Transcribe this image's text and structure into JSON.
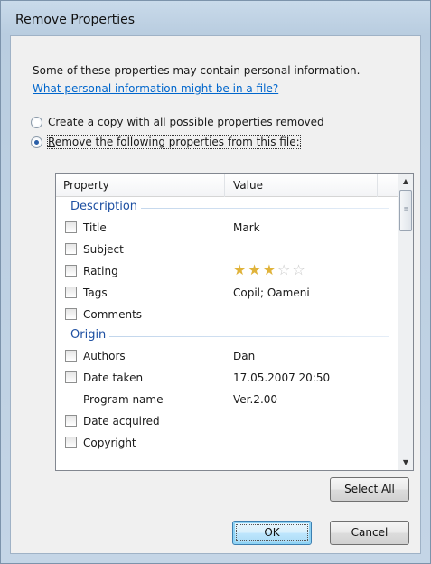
{
  "window": {
    "title": "Remove Properties"
  },
  "intro": {
    "text": "Some of these properties may contain personal information.",
    "link": "What personal information might be in a file?"
  },
  "options": {
    "copy_prefix": "C",
    "copy_rest": "reate a copy with all possible properties removed",
    "remove_prefix": "R",
    "remove_rest": "emove the following properties from this file:",
    "selected": "remove"
  },
  "list": {
    "columns": {
      "property": "Property",
      "value": "Value"
    },
    "groups": [
      {
        "name": "Description",
        "rows": [
          {
            "label": "Title",
            "value": "Mark",
            "checkbox": true
          },
          {
            "label": "Subject",
            "value": "",
            "checkbox": true
          },
          {
            "label": "Rating",
            "value": "",
            "checkbox": true,
            "rating": 3,
            "rating_max": 5
          },
          {
            "label": "Tags",
            "value": "Copil; Oameni",
            "checkbox": true
          },
          {
            "label": "Comments",
            "value": "",
            "checkbox": true
          }
        ]
      },
      {
        "name": "Origin",
        "rows": [
          {
            "label": "Authors",
            "value": "Dan",
            "checkbox": true
          },
          {
            "label": "Date taken",
            "value": "17.05.2007 20:50",
            "checkbox": true
          },
          {
            "label": "Program name",
            "value": "Ver.2.00",
            "checkbox": false
          },
          {
            "label": "Date acquired",
            "value": "",
            "checkbox": true
          },
          {
            "label": "Copyright",
            "value": "",
            "checkbox": true
          }
        ]
      }
    ]
  },
  "buttons": {
    "select_all_prefix": "Select ",
    "select_all_key": "A",
    "select_all_rest": "ll",
    "ok": "OK",
    "cancel": "Cancel"
  },
  "colors": {
    "group_heading": "#1e50a2",
    "link": "#0066cc",
    "star_on": "#e0b33a",
    "star_off": "#c9c9c9"
  },
  "icons": {
    "star": "star-icon",
    "scroll_up": "scroll-up-arrow-icon",
    "scroll_down": "scroll-down-arrow-icon"
  }
}
